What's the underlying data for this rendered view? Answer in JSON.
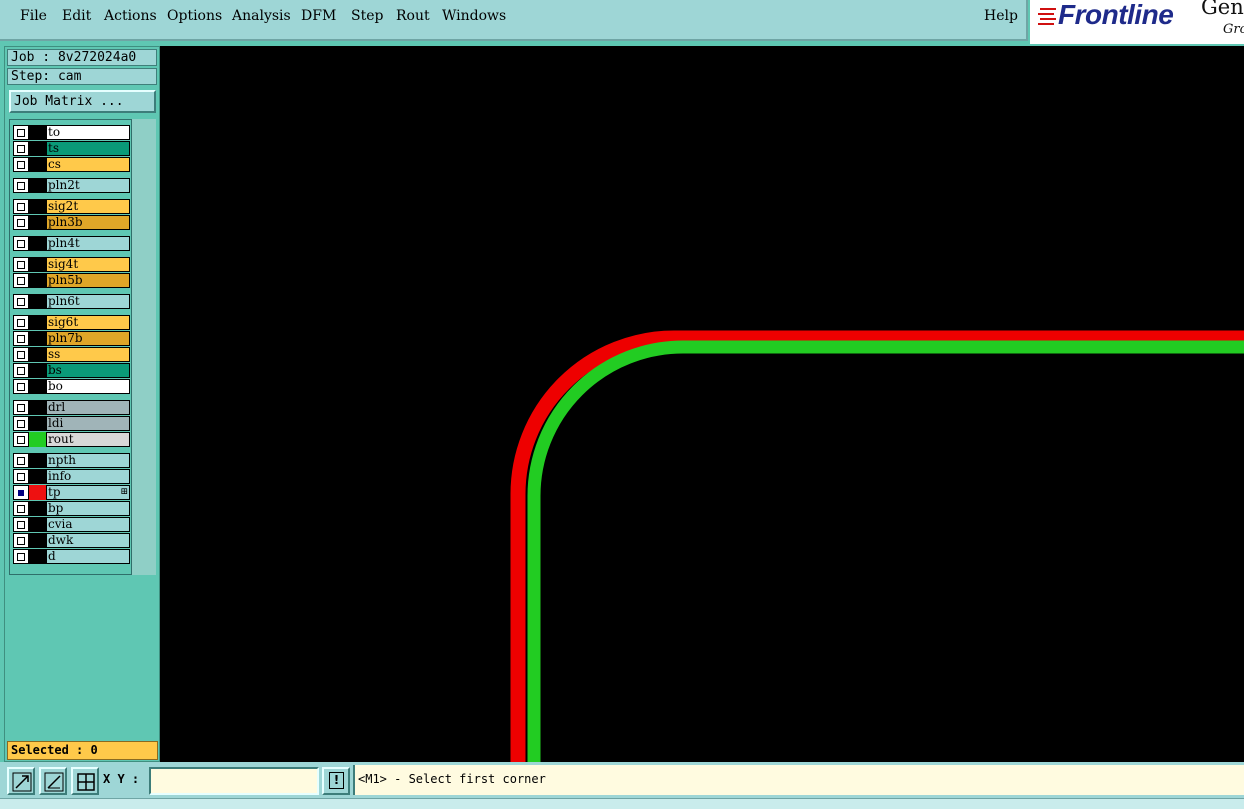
{
  "menu": {
    "items": [
      "File",
      "Edit",
      "Actions",
      "Options",
      "Analysis",
      "DFM",
      "Step",
      "Rout",
      "Windows"
    ],
    "help": "Help"
  },
  "logo": {
    "text": "Frontline",
    "gen": "Gen",
    "gro": "Gro"
  },
  "job": {
    "label": "Job : 8v272024a0",
    "step": "Step: cam"
  },
  "job_matrix_label": "Job Matrix ...",
  "layers": [
    {
      "name": "to",
      "color": "#ffffff",
      "checked": false,
      "swatch": "#000000"
    },
    {
      "name": "ts",
      "color": "#0a9a78",
      "checked": false,
      "swatch": "#000000"
    },
    {
      "name": "cs",
      "color": "#ffc94a",
      "checked": false,
      "swatch": "#000000"
    },
    {
      "name": "pln2t",
      "color": "#9ed6d6",
      "checked": false,
      "swatch": "#000000"
    },
    {
      "name": "sig2t",
      "color": "#ffc94a",
      "checked": false,
      "swatch": "#000000"
    },
    {
      "name": "pln3b",
      "color": "#e0a628",
      "checked": false,
      "swatch": "#000000"
    },
    {
      "name": "pln4t",
      "color": "#9ed6d6",
      "checked": false,
      "swatch": "#000000"
    },
    {
      "name": "sig4t",
      "color": "#ffc94a",
      "checked": false,
      "swatch": "#000000"
    },
    {
      "name": "pln5b",
      "color": "#e0a628",
      "checked": false,
      "swatch": "#000000"
    },
    {
      "name": "pln6t",
      "color": "#9ed6d6",
      "checked": false,
      "swatch": "#000000"
    },
    {
      "name": "sig6t",
      "color": "#ffc94a",
      "checked": false,
      "swatch": "#000000"
    },
    {
      "name": "pln7b",
      "color": "#e0a628",
      "checked": false,
      "swatch": "#000000"
    },
    {
      "name": "ss",
      "color": "#ffc94a",
      "checked": false,
      "swatch": "#000000"
    },
    {
      "name": "bs",
      "color": "#0a9a78",
      "checked": false,
      "swatch": "#000000"
    },
    {
      "name": "bo",
      "color": "#ffffff",
      "checked": false,
      "swatch": "#000000"
    },
    {
      "name": "drl",
      "color": "#a0b4b8",
      "checked": false,
      "swatch": "#000000"
    },
    {
      "name": "ldi",
      "color": "#a0b4b8",
      "checked": false,
      "swatch": "#000000"
    },
    {
      "name": "rout",
      "color": "#d8d8d8",
      "checked": false,
      "swatch": "#22cc22"
    },
    {
      "name": "npth",
      "color": "#9ed6d6",
      "checked": false,
      "swatch": "#000000"
    },
    {
      "name": "info",
      "color": "#9ed6d6",
      "checked": false,
      "swatch": "#000000"
    },
    {
      "name": "tp",
      "color": "#9ed6d6",
      "checked": true,
      "swatch": "#ee1111",
      "mark": "⊞"
    },
    {
      "name": "bp",
      "color": "#9ed6d6",
      "checked": false,
      "swatch": "#000000"
    },
    {
      "name": "cvia",
      "color": "#9ed6d6",
      "checked": false,
      "swatch": "#000000"
    },
    {
      "name": "dwk",
      "color": "#9ed6d6",
      "checked": false,
      "swatch": "#000000"
    },
    {
      "name": "d",
      "color": "#9ed6d6",
      "checked": false,
      "swatch": "#000000"
    }
  ],
  "selected_label": "Selected : 0",
  "xy": {
    "label": "X Y :",
    "value": "",
    "placeholder": ""
  },
  "prompt": "<M1> - Select first corner",
  "canvas": {
    "background": "#000000",
    "tracks": [
      {
        "layer": "tp",
        "color": "#ee0000"
      },
      {
        "layer": "rout",
        "color": "#22cc22"
      }
    ]
  }
}
